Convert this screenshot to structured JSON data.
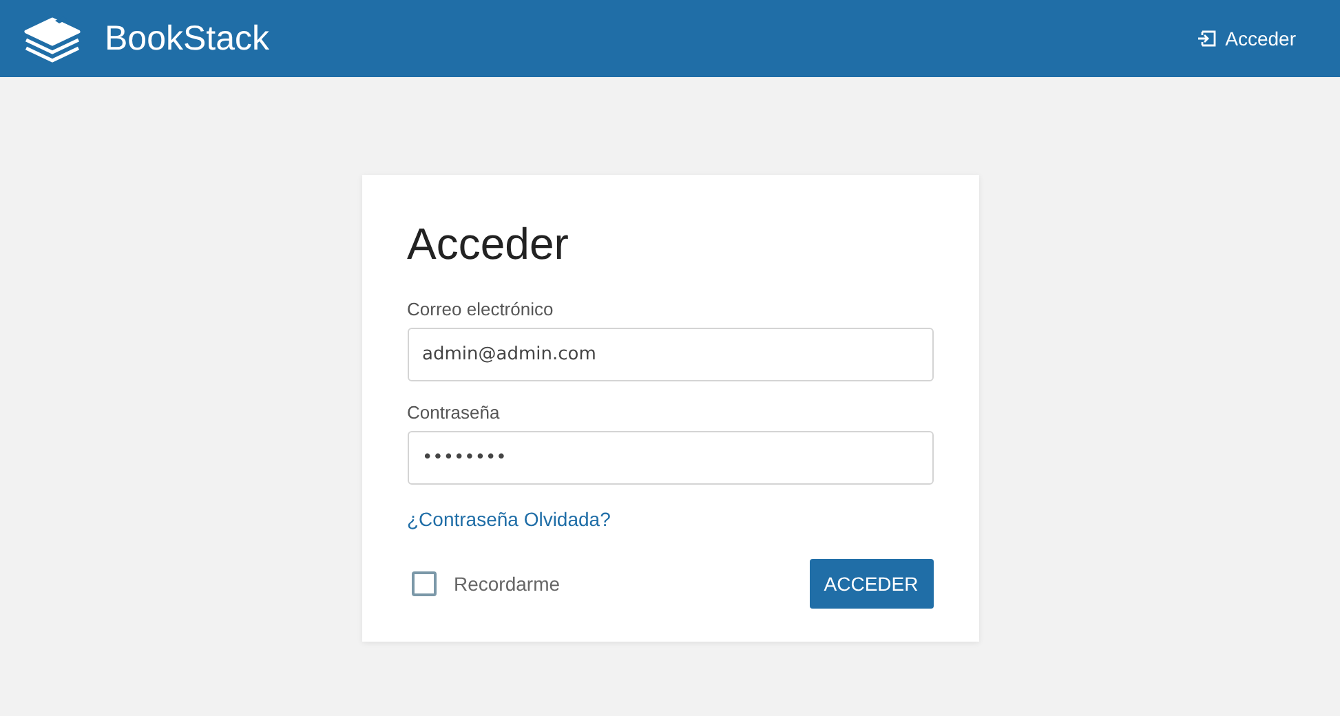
{
  "header": {
    "app_name": "BookStack",
    "login_link": "Acceder"
  },
  "login_card": {
    "title": "Acceder",
    "fields": [
      {
        "label": "Correo electrónico",
        "value": "admin@admin.com"
      },
      {
        "label": "Contraseña",
        "value": "••••••••"
      }
    ],
    "forgot_link": "¿Contraseña Olvidada?",
    "remember": {
      "label": "Recordarme",
      "checked": false
    },
    "submit_button": "ACCEDER"
  }
}
